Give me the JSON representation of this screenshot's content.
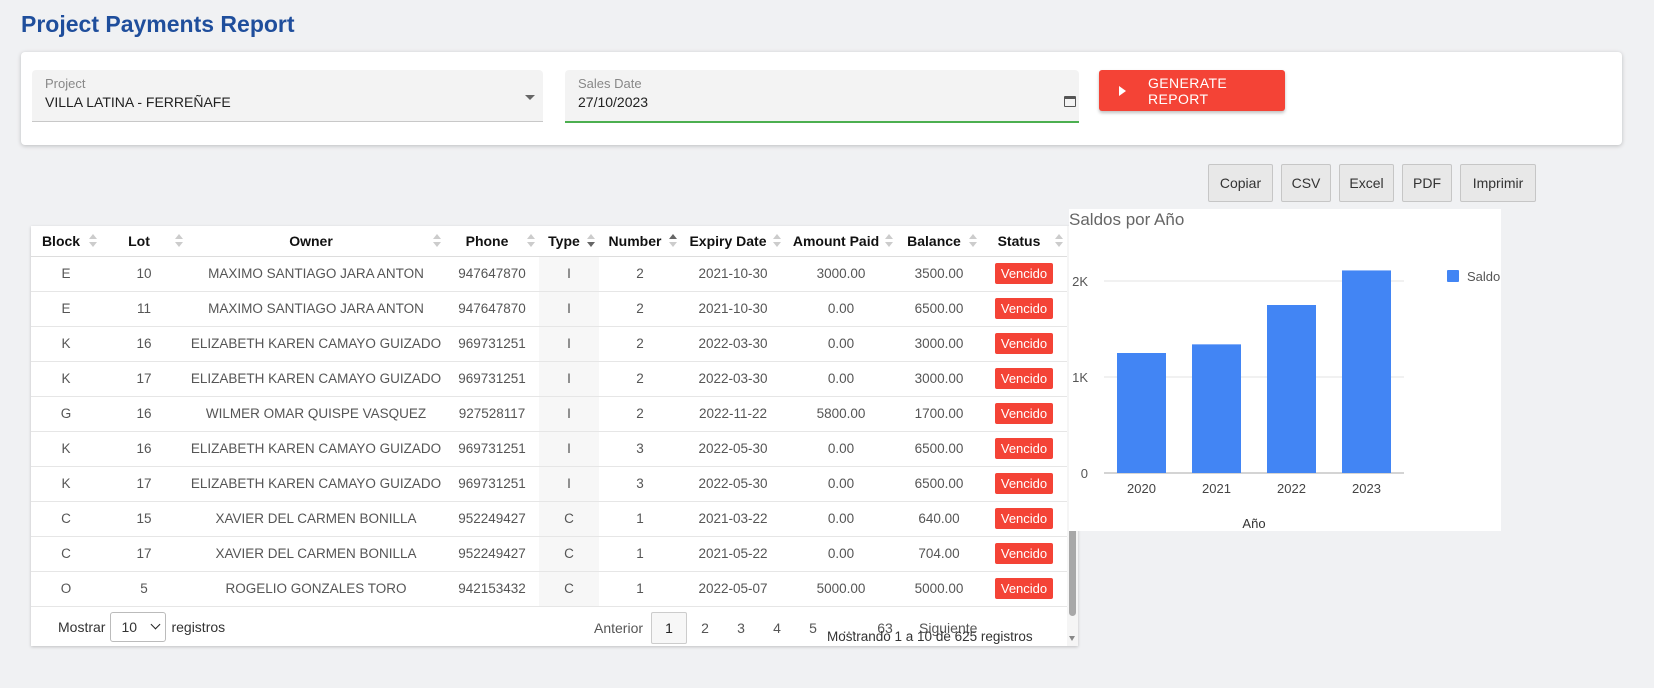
{
  "header": {
    "title": "Project Payments Report"
  },
  "filters": {
    "project": {
      "label": "Project",
      "value": "VILLA LATINA - FERREÑAFE"
    },
    "sales_date": {
      "label": "Sales Date",
      "value": "27/10/2023"
    },
    "generate_label": "GENERATE REPORT"
  },
  "export": {
    "copy": "Copiar",
    "csv": "CSV",
    "excel": "Excel",
    "pdf": "PDF",
    "print": "Imprimir"
  },
  "table": {
    "headers": [
      "Block",
      "Lot",
      "Owner",
      "Phone",
      "Type",
      "Number",
      "Expiry Date",
      "Amount Paid",
      "Balance",
      "Status"
    ],
    "rows": [
      [
        "E",
        "10",
        "MAXIMO SANTIAGO JARA ANTON",
        "947647870",
        "I",
        "2",
        "2021-10-30",
        "3000.00",
        "3500.00",
        "Vencido"
      ],
      [
        "E",
        "11",
        "MAXIMO SANTIAGO JARA ANTON",
        "947647870",
        "I",
        "2",
        "2021-10-30",
        "0.00",
        "6500.00",
        "Vencido"
      ],
      [
        "K",
        "16",
        "ELIZABETH KAREN CAMAYO GUIZADO",
        "969731251",
        "I",
        "2",
        "2022-03-30",
        "0.00",
        "3000.00",
        "Vencido"
      ],
      [
        "K",
        "17",
        "ELIZABETH KAREN CAMAYO GUIZADO",
        "969731251",
        "I",
        "2",
        "2022-03-30",
        "0.00",
        "3000.00",
        "Vencido"
      ],
      [
        "G",
        "16",
        "WILMER OMAR QUISPE VASQUEZ",
        "927528117",
        "I",
        "2",
        "2022-11-22",
        "5800.00",
        "1700.00",
        "Vencido"
      ],
      [
        "K",
        "16",
        "ELIZABETH KAREN CAMAYO GUIZADO",
        "969731251",
        "I",
        "3",
        "2022-05-30",
        "0.00",
        "6500.00",
        "Vencido"
      ],
      [
        "K",
        "17",
        "ELIZABETH KAREN CAMAYO GUIZADO",
        "969731251",
        "I",
        "3",
        "2022-05-30",
        "0.00",
        "6500.00",
        "Vencido"
      ],
      [
        "C",
        "15",
        "XAVIER DEL CARMEN BONILLA",
        "952249427",
        "C",
        "1",
        "2021-03-22",
        "0.00",
        "640.00",
        "Vencido"
      ],
      [
        "C",
        "17",
        "XAVIER DEL CARMEN BONILLA",
        "952249427",
        "C",
        "1",
        "2021-05-22",
        "0.00",
        "704.00",
        "Vencido"
      ],
      [
        "O",
        "5",
        "ROGELIO GONZALES TORO",
        "942153432",
        "C",
        "1",
        "2022-05-07",
        "5000.00",
        "5000.00",
        "Vencido"
      ]
    ],
    "status_color": "#f44336"
  },
  "length": {
    "prefix": "Mostrar",
    "value": "10",
    "suffix": "registros"
  },
  "pagination": {
    "prev": "Anterior",
    "pages": [
      "1",
      "2",
      "3",
      "4",
      "5",
      "…",
      "63"
    ],
    "next": "Siguiente",
    "current": "1"
  },
  "info": "Mostrando 1 a 10 de 625 registros",
  "chart_data": {
    "type": "bar",
    "title": "Saldos por Año",
    "categories": [
      "2020",
      "2021",
      "2022",
      "2023"
    ],
    "series": [
      {
        "name": "Saldo",
        "values": [
          1250,
          1340,
          1750,
          2110
        ],
        "color": "#4285f4"
      }
    ],
    "xlabel": "Año",
    "ylabel": "",
    "ylim": [
      0,
      2500
    ],
    "yticks": [
      {
        "value": 0,
        "label": "0"
      },
      {
        "value": 1000,
        "label": "1K"
      },
      {
        "value": 2000,
        "label": "2K"
      }
    ],
    "grid": true,
    "legend": "right"
  },
  "colors": {
    "title": "#1f4e9c",
    "accent": "#f44336",
    "date_underline": "#4caf50"
  }
}
